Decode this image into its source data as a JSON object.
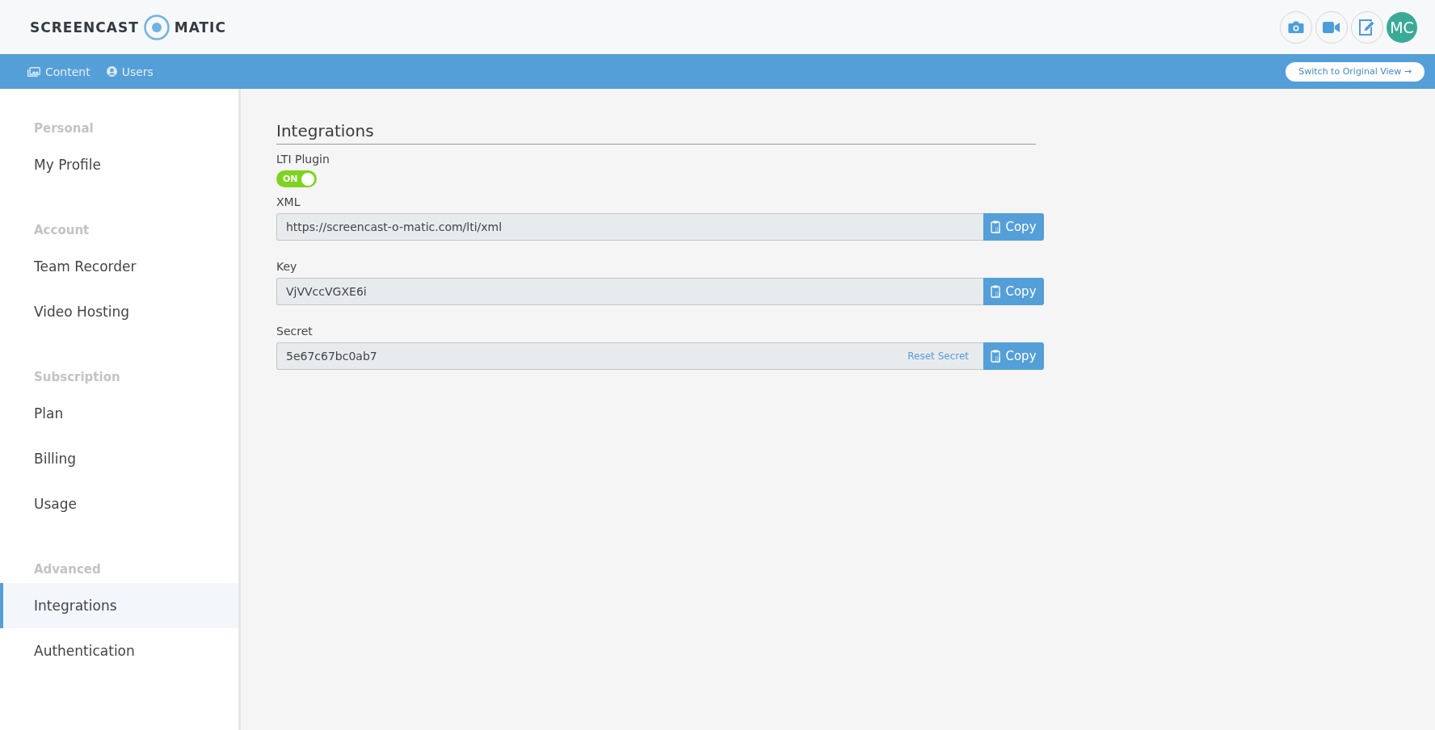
{
  "logo": {
    "left": "SCREENCAST",
    "right": "MATIC"
  },
  "header_actions": [
    {
      "kind": "camera"
    },
    {
      "kind": "video"
    },
    {
      "kind": "edit"
    }
  ],
  "avatar": {
    "initials": "MC"
  },
  "nav": [
    {
      "label": "Content",
      "kind": "content"
    },
    {
      "label": "Users",
      "kind": "users"
    }
  ],
  "switch_view": "Switch to Original View →",
  "sidebar": [
    {
      "heading": "Personal",
      "items": [
        {
          "label": "My Profile",
          "selected": false
        }
      ]
    },
    {
      "heading": "Account",
      "items": [
        {
          "label": "Team Recorder",
          "selected": false
        },
        {
          "label": "Video Hosting",
          "selected": false
        }
      ]
    },
    {
      "heading": "Subscription",
      "items": [
        {
          "label": "Plan",
          "selected": false
        },
        {
          "label": "Billing",
          "selected": false
        },
        {
          "label": "Usage",
          "selected": false
        }
      ]
    },
    {
      "heading": "Advanced",
      "items": [
        {
          "label": "Integrations",
          "selected": true
        },
        {
          "label": "Authentication",
          "selected": false
        }
      ]
    }
  ],
  "page_title": "Integrations",
  "plugin": {
    "label": "LTI Plugin",
    "toggle_label": "ON",
    "on": true
  },
  "fields": [
    {
      "label": "XML",
      "value": "https://screencast-o-matic.com/lti/xml",
      "button": "Copy"
    },
    {
      "label": "Key",
      "value": "VjVVccVGXE6i",
      "button": "Copy"
    },
    {
      "label": "Secret",
      "value": "5e67c67bc0ab7",
      "link": "Reset Secret",
      "button": "Copy"
    }
  ]
}
